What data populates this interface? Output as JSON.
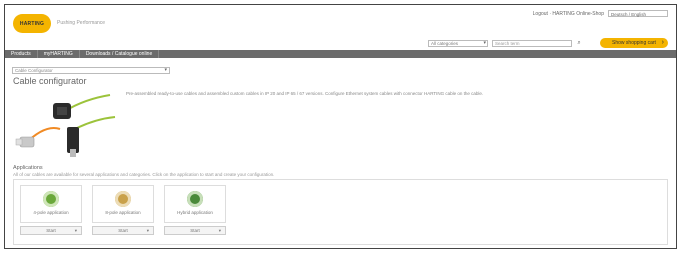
{
  "brand": {
    "logo_text": "HARTING",
    "tagline": "Pushing Performance"
  },
  "toplinks": {
    "text": "Logout · HARTING Online-Shop",
    "language": "Deutsch / English"
  },
  "search": {
    "category": "All categories",
    "placeholder": "Search term",
    "cart_button": "Show shopping cart"
  },
  "nav": {
    "items": [
      "Products",
      "myHARTING",
      "Downloads / Catalogue online"
    ]
  },
  "configurator": {
    "select_value": "Cable Configurator",
    "title": "Cable configurator",
    "description": "Pre-assembled ready-to-use cables and assembled custom cables in IP 20 and IP 65 / 67 versions. Configure Ethernet system cables with connector HARTING cable on the cable."
  },
  "applications": {
    "title": "Applications",
    "subtitle": "All of our cables are available for several applications and categories. Click on the application to start and create your configuration.",
    "tiles": [
      {
        "label": "4-pole application",
        "start": "Start",
        "color": "#6aa83a"
      },
      {
        "label": "8-pole application",
        "start": "Start",
        "color": "#c9a14a"
      },
      {
        "label": "Hybrid application",
        "start": "Start",
        "color": "#4a8a3a"
      }
    ]
  },
  "colors": {
    "accent": "#f4b400",
    "nav_bg": "#6b6b6b"
  }
}
